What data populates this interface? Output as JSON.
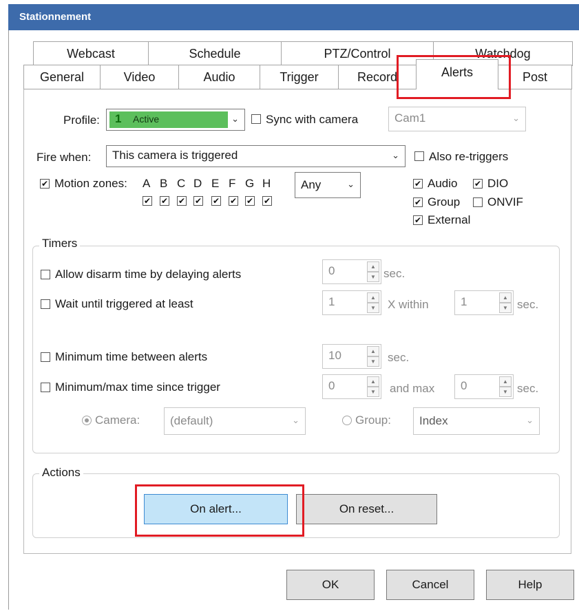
{
  "window": {
    "title": "Stationnement"
  },
  "tabs": {
    "row1": [
      "Webcast",
      "Schedule",
      "PTZ/Control",
      "Watchdog"
    ],
    "row2": [
      "General",
      "Video",
      "Audio",
      "Trigger",
      "Record",
      "Alerts",
      "Post"
    ],
    "active": "Alerts"
  },
  "profile": {
    "label": "Profile:",
    "number": "1",
    "value": "Active",
    "color": "#5cbf5c",
    "sync_label": "Sync with camera",
    "sync_checked": false,
    "camera_value": "Cam1"
  },
  "fire_when": {
    "label": "Fire when:",
    "value": "This camera is triggered",
    "also_retriggers_label": "Also re-triggers",
    "also_retriggers_checked": false
  },
  "motion": {
    "label": "Motion zones:",
    "checked": true,
    "zones": [
      "A",
      "B",
      "C",
      "D",
      "E",
      "F",
      "G",
      "H"
    ],
    "zones_checked": [
      true,
      true,
      true,
      true,
      true,
      true,
      true,
      true
    ],
    "match_value": "Any"
  },
  "sources": [
    {
      "label": "Audio",
      "checked": true
    },
    {
      "label": "DIO",
      "checked": true
    },
    {
      "label": "Group",
      "checked": true
    },
    {
      "label": "ONVIF",
      "checked": false
    },
    {
      "label": "External",
      "checked": true
    }
  ],
  "timers": {
    "title": "Timers",
    "disarm": {
      "label": "Allow disarm time by delaying alerts",
      "value": "0",
      "unit": "sec."
    },
    "wait": {
      "label": "Wait until triggered at least",
      "value": "1",
      "mid": "X within",
      "value2": "1",
      "unit": "sec."
    },
    "min_between": {
      "label": "Minimum time between alerts",
      "value": "10",
      "unit": "sec."
    },
    "min_max": {
      "label": "Minimum/max time since trigger",
      "value": "0",
      "mid": "and max",
      "value2": "0",
      "unit": "sec."
    },
    "camera_radio_label": "Camera:",
    "camera_select": "(default)",
    "group_radio_label": "Group:",
    "group_select": "Index"
  },
  "actions": {
    "title": "Actions",
    "on_alert": "On alert...",
    "on_reset": "On reset..."
  },
  "footer": {
    "ok": "OK",
    "cancel": "Cancel",
    "help": "Help"
  },
  "glyphs": {
    "check": "✔",
    "down": "⌄",
    "up": "▲",
    "dn": "▼"
  }
}
